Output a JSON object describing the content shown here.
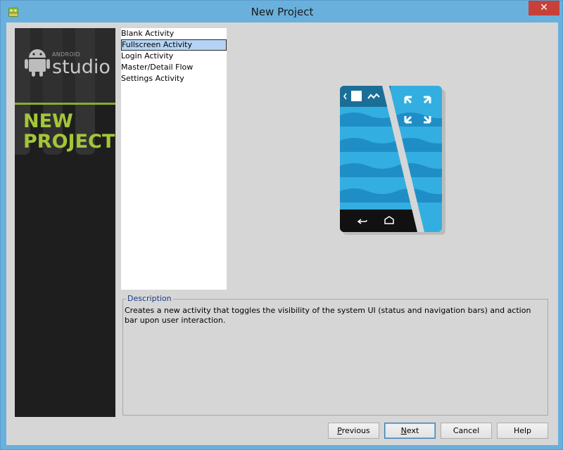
{
  "window": {
    "title": "New Project",
    "close_glyph": "✕",
    "icon": "android-icon"
  },
  "sidebar": {
    "brand_small": "ANDROID",
    "brand_large": "studio",
    "heading_line1": "NEW",
    "heading_line2": "PROJECT",
    "accent_color": "#a4c639"
  },
  "templates": {
    "items": [
      {
        "label": "Blank Activity",
        "selected": false
      },
      {
        "label": "Fullscreen Activity",
        "selected": true
      },
      {
        "label": "Login Activity",
        "selected": false
      },
      {
        "label": "Master/Detail Flow",
        "selected": false
      },
      {
        "label": "Settings Activity",
        "selected": false
      }
    ]
  },
  "preview": {
    "icon": "fullscreen-phone-preview",
    "colors": {
      "sea": "#33aee0",
      "wave": "#1f8ec7",
      "bar": "#111111"
    }
  },
  "description": {
    "legend": "Description",
    "text": "Creates a new activity that toggles the visibility of the system UI (status and navigation bars) and action bar upon user interaction."
  },
  "buttons": {
    "previous": {
      "mnemonic": "P",
      "rest": "revious"
    },
    "next": {
      "mnemonic": "N",
      "rest": "ext"
    },
    "cancel": "Cancel",
    "help": "Help"
  }
}
